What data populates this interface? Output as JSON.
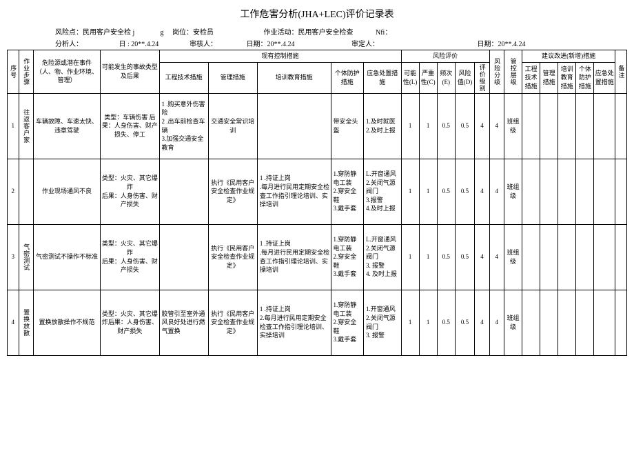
{
  "title": "工作危害分析(JHA+LEC)评价记录表",
  "header": {
    "risk_point_label": "风险点：",
    "risk_point_value": "民用客户安全检 j",
    "g": "g",
    "post_label": "岗位：",
    "post_value": "安检员",
    "activity_label": "作业活动：",
    "activity_value": "民用客户安全检查",
    "nfi": "Nfi：",
    "analyst_label": "分析人：",
    "date1_label": "日 :",
    "date1_value": "20**.4.24",
    "auditor_label": "审核人：",
    "date2_label": "日期：",
    "date2_value": "20**.4.24",
    "approver_label": "审定人：",
    "date3_label": "日期：",
    "date3_value": "20**.4.24"
  },
  "thead": {
    "seq": "序号",
    "step": "作业步骤",
    "hazard": "危险源或潜在事件（人、物、作业环境、管理）",
    "accident": "可能发生的事故类型及后果",
    "existing_control": "现有控制措施",
    "eng": "工程技术措施",
    "mgmt": "管理措施",
    "train": "培训教育措施",
    "ppe": "个体防护措施",
    "emerg": "应急处置措施",
    "risk_eval": "风险评价",
    "l": "可能性(L)",
    "c": "严重性(C)",
    "e": "频次(E)",
    "d": "风险值(D)",
    "rank": "评价级别",
    "risk_grade": "风险分级",
    "ctrl_grade": "管控层级",
    "suggest": "建议改进(新增)措施",
    "sug_eng": "工程技术措施",
    "sug_mgmt": "管理措施",
    "sug_train": "培训教育措施",
    "sug_ppe": "个体防护措施",
    "sug_emerg": "应急处置措施",
    "remark": "备注"
  },
  "rows": [
    {
      "seq": "1",
      "step": "往返客户家",
      "hazard": "车辆故障、车速太快、违章驾驶",
      "accident": "类型：车辆伤害 后果：人身伤害、财产损失、停工",
      "eng": "1        .购买意外伤害险\n2        .出车前检查车辆\n3.加强交通安全教育",
      "mgmt": "交通安全常识培训",
      "train": "",
      "ppe": "带安全头盔",
      "emerg": "1.及时就医\n2.及时上报",
      "l": "1",
      "c": "1",
      "e": "0.5",
      "d": "0.5",
      "rank": "4",
      "risk_grade": "4",
      "ctrl_grade": "班组级"
    },
    {
      "seq": "2",
      "step": "",
      "hazard": "作业现场通风不良",
      "accident": "类型：火灾、其它爆炸\n后果：人身伤害、财产损失",
      "eng": "",
      "mgmt": "执行《民用客户安全检查作业规定》",
      "train": "1        .持证上岗\n        .每月进行民用定期安全检查工作指引理论培训、实操培训",
      "ppe": "1.穿防静电工装\n2.穿安全鞋\n3.戴手套",
      "emerg": "L.开窗通风\n2.关闭气源阀门\n3.报警\n4.及时上报",
      "l": "1",
      "c": "1",
      "e": "0.5",
      "d": "0.5",
      "rank": "4",
      "risk_grade": "4",
      "ctrl_grade": "班组级"
    },
    {
      "seq": "3",
      "step": "气密测试",
      "hazard": "气密测试不操作不标准",
      "accident": "类型：火灾、其它爆炸\n后果：人身伤害、财产损失",
      "eng": "",
      "mgmt": "执行《民用客户安全检查作业规定》",
      "train": "1        .持证上岗\n        .每月进行民用定期安全检查工作指引理论培训、实操培训",
      "ppe": "1.穿防静电工装\n2.穿安全鞋\n3.戴手套",
      "emerg": "L.开窗通风\n2.关闭气源阀门\n3. 报警\n4. 及时上报",
      "l": "1",
      "c": "1",
      "e": "0.5",
      "d": "0.5",
      "rank": "4",
      "risk_grade": "4",
      "ctrl_grade": "班组级"
    },
    {
      "seq": "4",
      "step": "置换放散",
      "hazard": "置换放散操作不规范",
      "accident": "类型：火灾、其它爆炸后果：人身伤害、财产损失",
      "eng": "胶管引至室外通风良好处进行燃气置换",
      "mgmt": "执行《民用客户安全检查作业规定》",
      "train": "1        .持证上岗\n2.每月进行民用定期安全检查工作指引理论培训、实操培训",
      "ppe": "1.穿防静电工装\n2.穿安全鞋\n3.戴手套",
      "emerg": "1.开窗通风\n2.关闭气源阀门\n3. 报警",
      "l": "1",
      "c": "1",
      "e": "0.5",
      "d": "0.5",
      "rank": "4",
      "risk_grade": "4",
      "ctrl_grade": "班组级"
    }
  ]
}
